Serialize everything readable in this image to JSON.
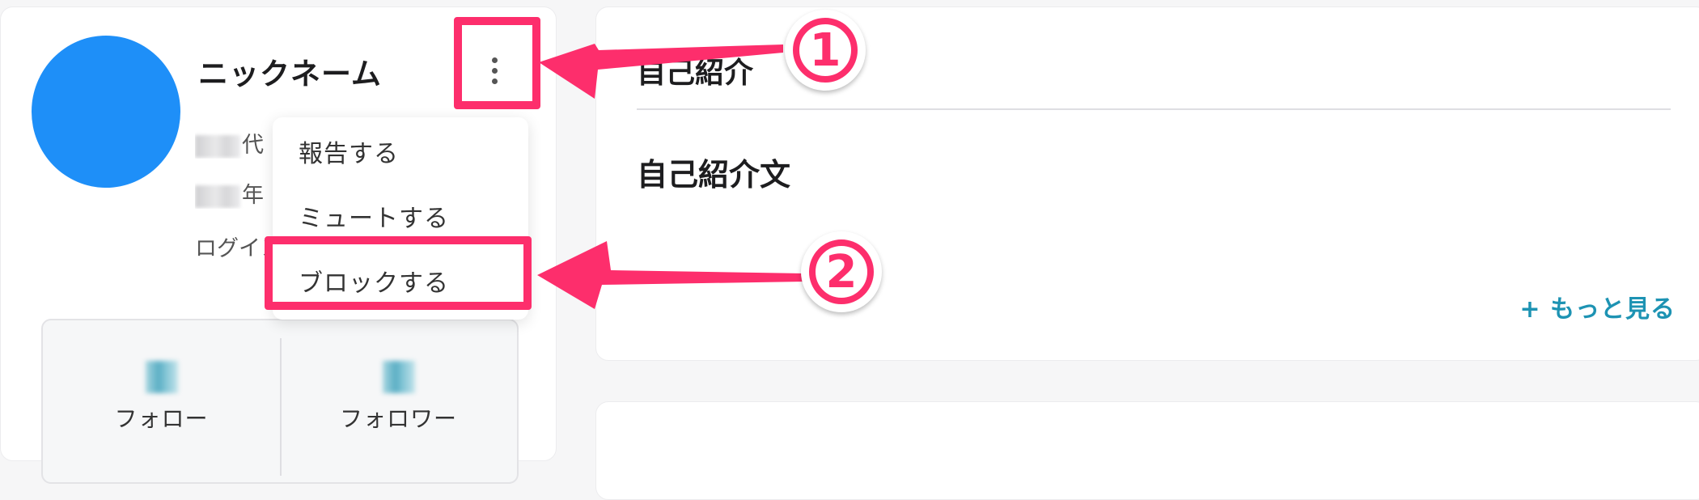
{
  "profile": {
    "nickname": "ニックネーム",
    "age_suffix": "代",
    "years_suffix": "年",
    "login_label": "ログイン"
  },
  "menu": {
    "report": "報告する",
    "mute": "ミュートする",
    "block": "ブロックする"
  },
  "stats": {
    "follow_label": "フォロー",
    "follower_label": "フォロワー"
  },
  "intro": {
    "title": "自己紹介",
    "text": "自己紹介文",
    "more": "+ もっと見る"
  },
  "callouts": [
    "1",
    "2"
  ],
  "colors": {
    "avatar": "#1e8ff8",
    "highlight": "#fd2e6c",
    "link": "#1d93b3"
  },
  "icons": [
    "kebab-menu-icon",
    "arrow-annotation"
  ]
}
